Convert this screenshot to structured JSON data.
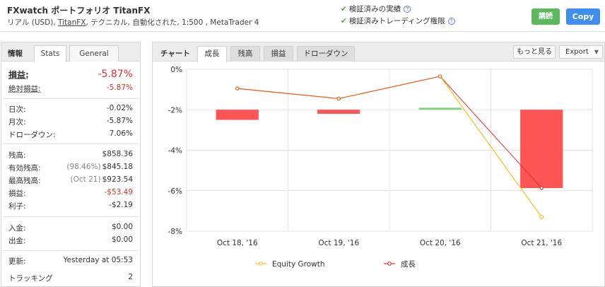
{
  "header": {
    "title": "FXwatch ポートフォリオ TitanFX",
    "subtitle_prefix": "リアル (USD), ",
    "broker": "TitanFX",
    "subtitle_suffix": ", テクニカル, 自動化された, 1:500 , MetaTrader 4",
    "verify_track": "検証済みの実績",
    "verify_trading": "検証済みトレーディング権限",
    "follow_button": "講読",
    "copy_button": "Copy"
  },
  "left": {
    "header_label": "情報",
    "tab_stats": "Stats",
    "tab_general": "General",
    "gain_label": "損益:",
    "gain_value": "-5.87%",
    "abs_gain_label": "絶対損益:",
    "abs_gain_value": "-5.87%",
    "daily_label": "日次:",
    "daily_value": "-0.02%",
    "monthly_label": "月次:",
    "monthly_value": "-5.87%",
    "drawdown_label": "ドローダウン:",
    "drawdown_value": "7.06%",
    "balance_label": "残高:",
    "balance_value": "$858.36",
    "equity_label": "有効残高:",
    "equity_pct": "(98.46%)",
    "equity_value": "$845.18",
    "highest_label": "最高残高:",
    "highest_date": "(Oct 21)",
    "highest_value": "$923.54",
    "profit_label": "損益:",
    "profit_value": "-$53.49",
    "interest_label": "利子:",
    "interest_value": "-$2.19",
    "deposits_label": "入金:",
    "deposits_value": "$0.00",
    "withdrawals_label": "出金:",
    "withdrawals_value": "$0.00",
    "updated_label": "更新:",
    "updated_value": "Yesterday at 05:53",
    "tracking_label": "トラッキング",
    "tracking_value": "2"
  },
  "right": {
    "header_label": "チャート",
    "tabs": [
      "成長",
      "残高",
      "損益",
      "ドローダウン"
    ],
    "more_button": "もっと見る",
    "export_button": "Export"
  },
  "colors": {
    "equity_line": "#f2c31b",
    "growth_line": "#e0302c",
    "growth_marker": "#e0302c",
    "bar_negative": "#ff4b4b",
    "bar_positive": "#7dcc7d",
    "orange_line": "#e8631f"
  },
  "chart_data": {
    "type": "line",
    "categories": [
      "Oct 18, '16",
      "Oct 19, '16",
      "Oct 20, '16",
      "Oct 21, '16"
    ],
    "ylim": [
      -8,
      0
    ],
    "yticks": [
      "0%",
      "-2%",
      "-4%",
      "-6%",
      "-8%"
    ],
    "grid": true,
    "legend_placement": "bottom",
    "series": [
      {
        "name": "Equity Growth",
        "type": "line",
        "values": [
          null,
          null,
          -0.35,
          -7.3
        ]
      },
      {
        "name": "成長",
        "type": "line",
        "values": [
          -0.95,
          -1.45,
          -0.35,
          -5.87
        ]
      }
    ],
    "bars": [
      {
        "from": -2.0,
        "to": -2.5
      },
      {
        "from": -2.0,
        "to": -2.2
      },
      {
        "from": -2.0,
        "to": -1.9
      },
      {
        "from": -2.0,
        "to": -5.87
      }
    ]
  }
}
